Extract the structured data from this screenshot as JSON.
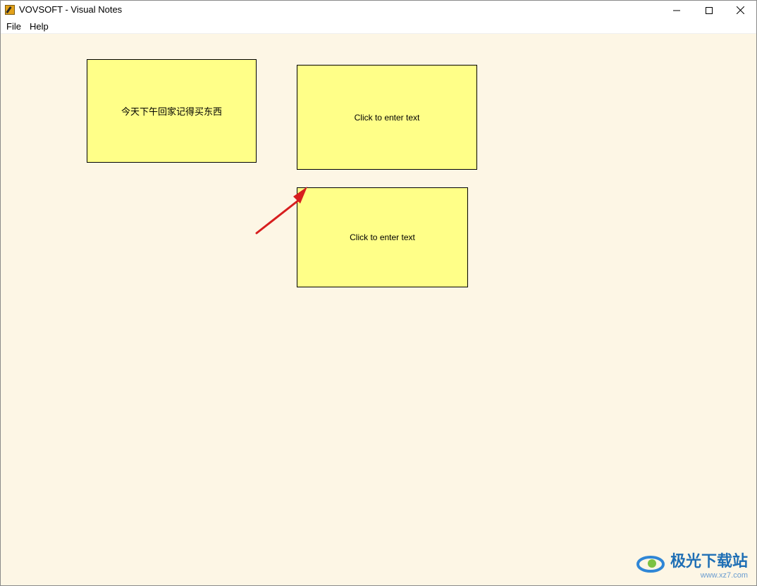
{
  "window": {
    "title": "VOVSOFT - Visual Notes",
    "icon": "pencil-app-icon"
  },
  "menu": {
    "items": [
      {
        "label": "File"
      },
      {
        "label": "Help"
      }
    ]
  },
  "notes": [
    {
      "text": "今天下午回家记得买东西"
    },
    {
      "text": "Click to enter text"
    },
    {
      "text": "Click to enter text"
    }
  ],
  "watermark": {
    "text": "极光下载站",
    "url": "www.xz7.com"
  },
  "colors": {
    "canvas": "#fdf6e5",
    "note": "#ffff88",
    "arrow": "#d71e1e"
  }
}
